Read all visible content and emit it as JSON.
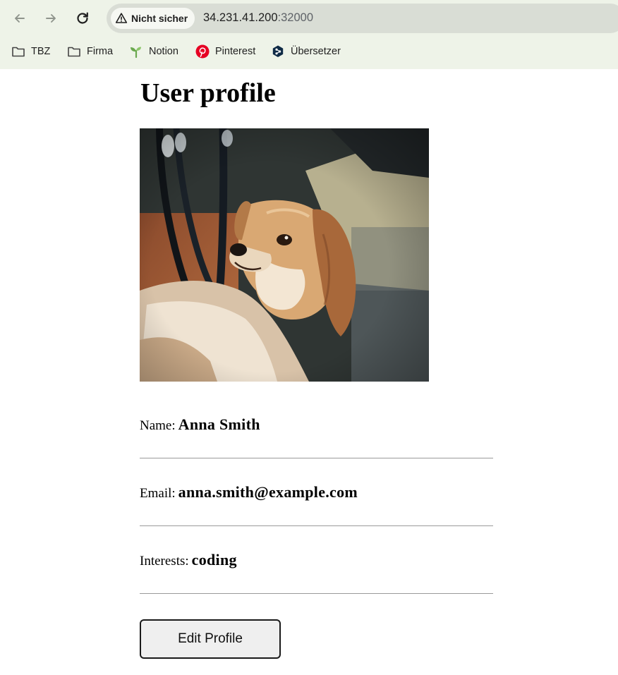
{
  "browser": {
    "security_label": "Nicht sicher",
    "url_host": "34.231.41.200",
    "url_port": ":32000",
    "bookmarks": [
      {
        "label": "TBZ",
        "icon": "folder-icon"
      },
      {
        "label": "Firma",
        "icon": "folder-icon"
      },
      {
        "label": "Notion",
        "icon": "sprout-icon"
      },
      {
        "label": "Pinterest",
        "icon": "pinterest-icon"
      },
      {
        "label": "Übersetzer",
        "icon": "deepl-icon"
      }
    ]
  },
  "page": {
    "title": "User profile",
    "photo_subject": "dog-photo",
    "fields": [
      {
        "label": "Name:",
        "value": "Anna Smith"
      },
      {
        "label": "Email:",
        "value": "anna.smith@example.com"
      },
      {
        "label": "Interests:",
        "value": "coding"
      }
    ],
    "edit_button_label": "Edit Profile"
  },
  "colors": {
    "chrome_background": "#eef3e8",
    "omnibox_background": "#d9ddd5",
    "pinterest_red": "#e60023",
    "notion_sprout_green": "#6aa84f",
    "deepl_navy": "#0f2b46"
  }
}
